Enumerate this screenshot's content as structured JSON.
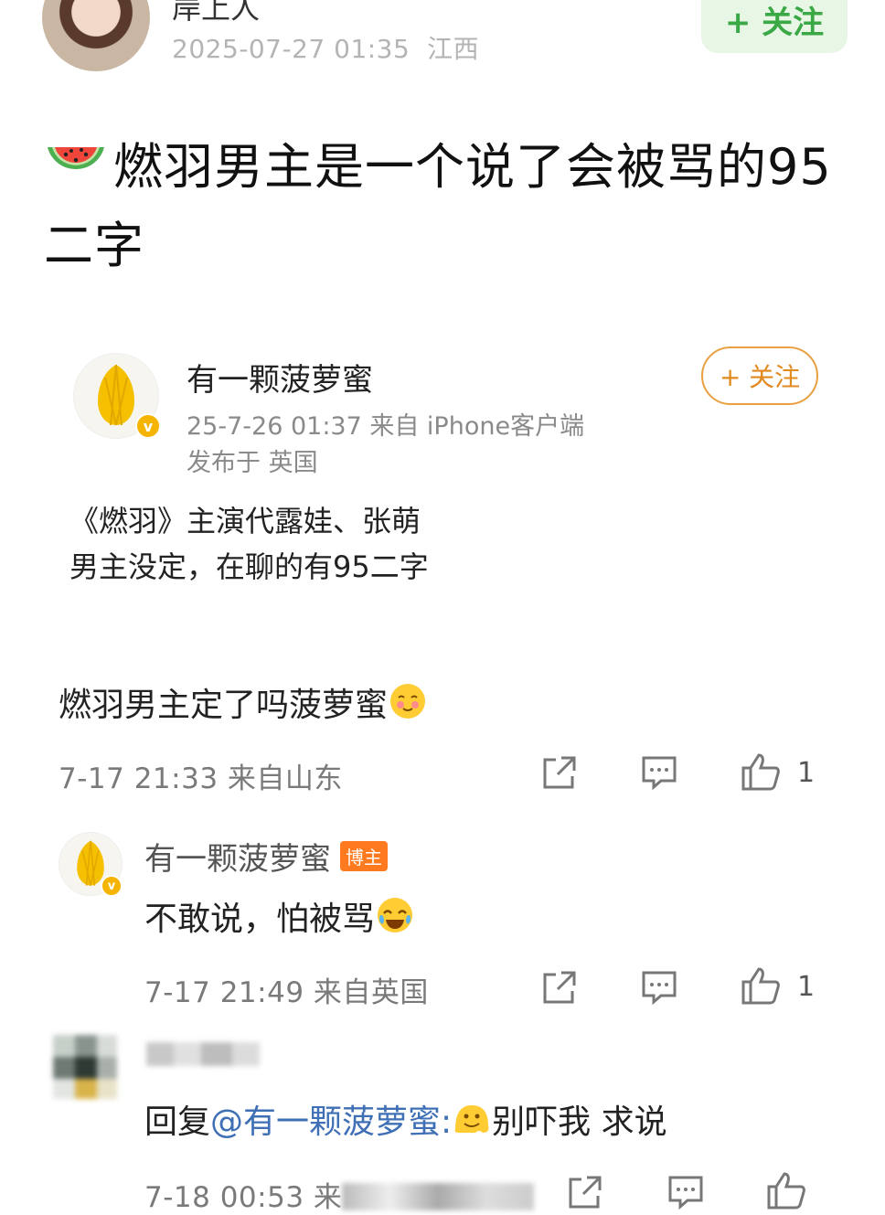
{
  "post": {
    "username": "岸上人",
    "timestamp": "2025-07-27 01:35",
    "location": "江西",
    "follow_label": "+ 关注",
    "title": "燃羽男主是一个说了会被骂的95二字"
  },
  "embedded": {
    "username": "有一颗菠萝蜜",
    "time_source": "25-7-26 01:37   来自 iPhone客户端",
    "location": "发布于 英国",
    "follow_label": "+ 关注",
    "body_line1": "《燃羽》主演代露娃、张萌",
    "body_line2": "男主没定，在聊的有95二字"
  },
  "comments": [
    {
      "text": "燃羽男主定了吗菠萝蜜",
      "meta": "7-17 21:33  来自山东",
      "likes": "1"
    },
    {
      "username": "有一颗菠萝蜜",
      "badge": "博主",
      "text": "不敢说，怕被骂",
      "meta": "7-17 21:49  来自英国",
      "likes": "1"
    },
    {
      "reply_prefix": "回复",
      "mention": "@有一颗菠萝蜜:",
      "text": "别吓我 求说",
      "meta": "7-18 00:53  来"
    }
  ],
  "icons": {
    "share": "share-icon",
    "comment": "comment-icon",
    "like": "thumbs-up-icon",
    "watermelon": "watermelon-emoji",
    "verify": "verified-badge-icon"
  },
  "colors": {
    "follow_green": "#3aa845",
    "follow_orange": "#e08a20",
    "badge_orange": "#ff7a1f",
    "mention_blue": "#3f6fb5"
  }
}
